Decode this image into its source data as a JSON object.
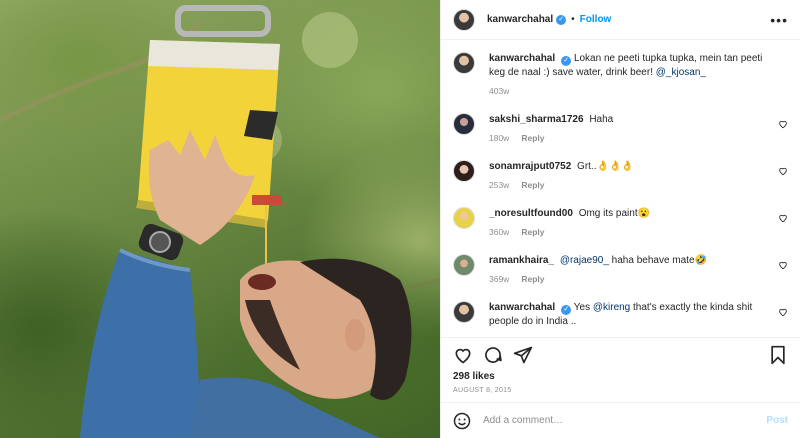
{
  "header": {
    "username": "kanwarchahal",
    "follow_label": "Follow",
    "dot": "•",
    "more_label": "•••"
  },
  "caption": {
    "username": "kanwarchahal",
    "text": "Lokan ne peeti tupka tupka, mein tan peeti keg de naal :) save water, drink beer! ",
    "mention": "@_kjosan_",
    "time": "403w"
  },
  "comments": [
    {
      "username": "sakshi_sharma1726",
      "text": "Haha",
      "mention": "",
      "time": "180w",
      "reply": "Reply"
    },
    {
      "username": "sonamrajput0752",
      "text": "Grt..👌👌👌",
      "mention": "",
      "time": "253w",
      "reply": "Reply"
    },
    {
      "username": "_noresultfound00",
      "text": "Omg its paint😮",
      "mention": "",
      "time": "360w",
      "reply": "Reply"
    },
    {
      "username": "ramankhaira_",
      "text": " haha behave mate🤣",
      "mention": "@rajae90_",
      "time": "369w",
      "reply": "Reply"
    },
    {
      "username": "kanwarchahal",
      "text": " that's exactly the kinda shit people do in India ..",
      "mention": "@kireng",
      "pre": "Yes ",
      "time": "",
      "reply": ""
    }
  ],
  "likes": "298 likes",
  "date": "AUGUST 8, 2015",
  "composer": {
    "placeholder": "Add a comment…",
    "post_label": "Post"
  },
  "colors": {
    "accent": "#0095f6",
    "verified": "#3897f0",
    "muted": "#8e8e8e"
  },
  "icons": [
    "verified-badge-icon",
    "more-options-icon",
    "heart-icon",
    "comment-icon",
    "share-icon",
    "bookmark-icon",
    "emoji-icon"
  ]
}
